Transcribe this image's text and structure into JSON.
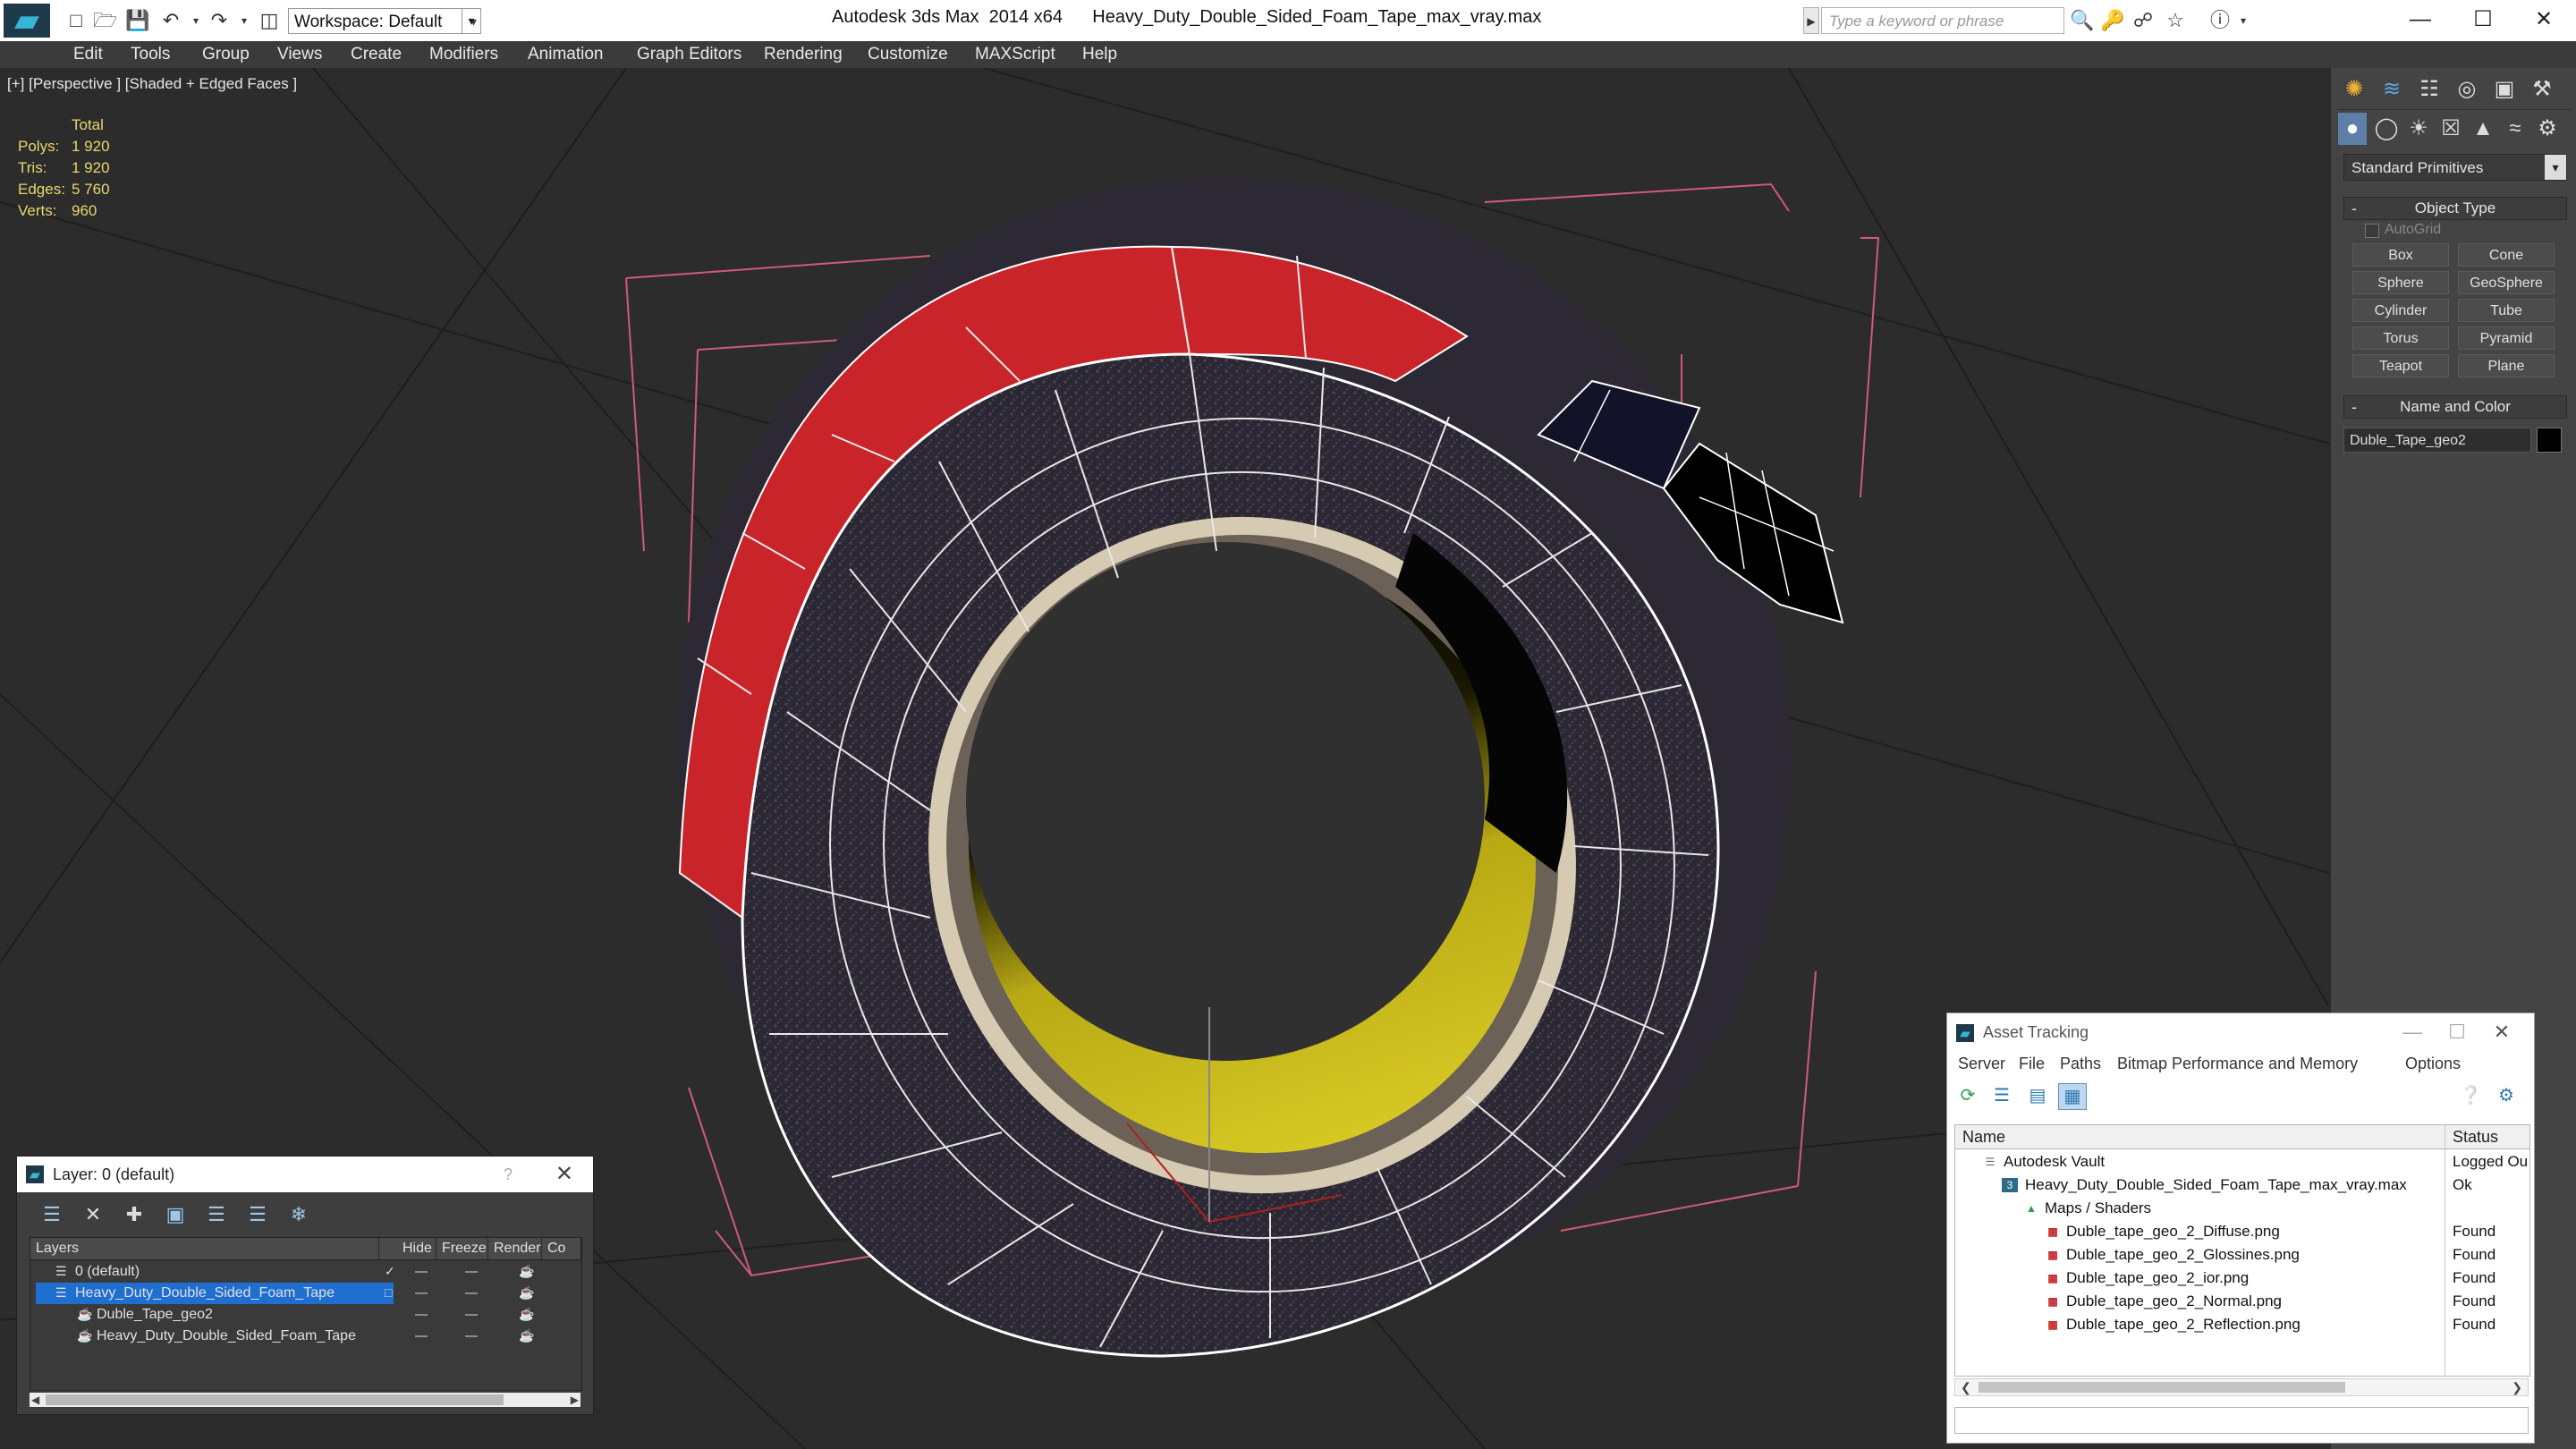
{
  "window": {
    "title": "Autodesk 3ds Max  2014 x64      Heavy_Duty_Double_Sided_Foam_Tape_max_vray.max",
    "logo_glyph": "▰",
    "workspace_label": "Workspace: Default",
    "search_placeholder": "Type a keyword or phrase",
    "minimize": "—",
    "maximize": "☐",
    "close": "✕"
  },
  "menu": {
    "items": [
      "Edit",
      "Tools",
      "Group",
      "Views",
      "Create",
      "Modifiers",
      "Animation",
      "Graph Editors",
      "Rendering",
      "Customize",
      "MAXScript",
      "Help"
    ]
  },
  "viewport": {
    "label": "[+] [Perspective ] [Shaded + Edged Faces ]",
    "stats": {
      "header": "Total",
      "rows": [
        {
          "key": "Polys:",
          "value": "1 920"
        },
        {
          "key": "Tris:",
          "value": "1 920"
        },
        {
          "key": "Edges:",
          "value": "5 760"
        },
        {
          "key": "Verts:",
          "value": "960"
        }
      ]
    },
    "colors": {
      "red": "#c8242a",
      "yellow": "#d2c51e",
      "dark": "#2a2733",
      "stats": "#e6d86b"
    }
  },
  "command_panel": {
    "dropdown": "Standard Primitives",
    "object_type_title": "Object Type",
    "autogrid_label": "AutoGrid",
    "primitives": [
      "Box",
      "Cone",
      "Sphere",
      "GeoSphere",
      "Cylinder",
      "Tube",
      "Torus",
      "Pyramid",
      "Teapot",
      "Plane"
    ],
    "name_color_title": "Name and Color",
    "object_name": "Duble_Tape_geo2"
  },
  "layer_window": {
    "title": "Layer: 0 (default)",
    "help": "?",
    "close": "✕",
    "columns": [
      "Layers",
      "Hide",
      "Freeze",
      "Render",
      "Co"
    ],
    "rows": [
      {
        "name": "0 (default)",
        "indent": 1,
        "selected": false,
        "check": true
      },
      {
        "name": "Heavy_Duty_Double_Sided_Foam_Tape",
        "indent": 1,
        "selected": true,
        "check": false
      },
      {
        "name": "Duble_Tape_geo2",
        "indent": 2,
        "selected": false,
        "check": false
      },
      {
        "name": "Heavy_Duty_Double_Sided_Foam_Tape",
        "indent": 2,
        "selected": false,
        "check": false
      }
    ]
  },
  "asset_tracking": {
    "title": "Asset Tracking",
    "menu": [
      "Server",
      "File",
      "Paths",
      "Bitmap Performance and Memory",
      "Options"
    ],
    "columns": [
      "Name",
      "Status"
    ],
    "rows": [
      {
        "name": "Autodesk Vault",
        "status": "Logged Ou",
        "indent": 0,
        "icon": "vault"
      },
      {
        "name": "Heavy_Duty_Double_Sided_Foam_Tape_max_vray.max",
        "status": "Ok",
        "indent": 1,
        "icon": "max"
      },
      {
        "name": "Maps / Shaders",
        "status": "",
        "indent": 2,
        "icon": "maps"
      },
      {
        "name": "Duble_tape_geo_2_Diffuse.png",
        "status": "Found",
        "indent": 3,
        "icon": "png"
      },
      {
        "name": "Duble_tape_geo_2_Glossines.png",
        "status": "Found",
        "indent": 3,
        "icon": "png"
      },
      {
        "name": "Duble_tape_geo_2_ior.png",
        "status": "Found",
        "indent": 3,
        "icon": "png"
      },
      {
        "name": "Duble_tape_geo_2_Normal.png",
        "status": "Found",
        "indent": 3,
        "icon": "png"
      },
      {
        "name": "Duble_tape_geo_2_Reflection.png",
        "status": "Found",
        "indent": 3,
        "icon": "png"
      }
    ]
  }
}
